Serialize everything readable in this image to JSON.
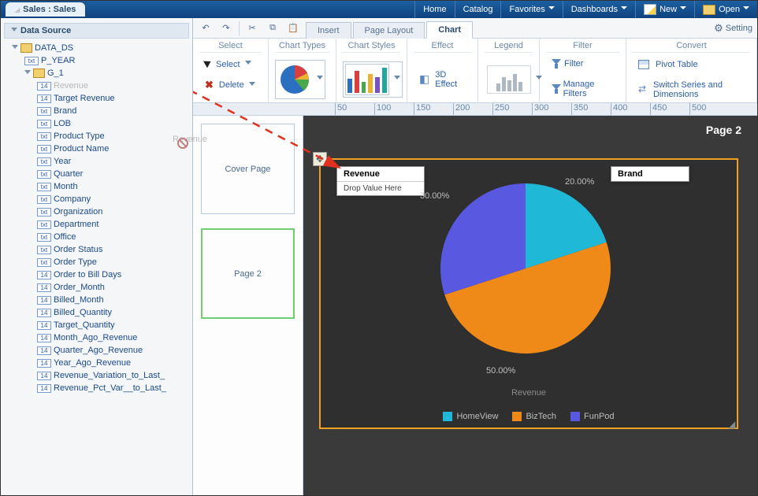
{
  "title": "Sales : Sales",
  "topmenu": {
    "home": "Home",
    "catalog": "Catalog",
    "favorites": "Favorites",
    "dashboards": "Dashboards",
    "new": "New",
    "open": "Open"
  },
  "sidebar": {
    "heading": "Data Source",
    "root": "DATA_DS",
    "p_year": "P_YEAR",
    "group": "G_1",
    "fields": [
      {
        "k": "num",
        "l": "Revenue",
        "dim": true
      },
      {
        "k": "num",
        "l": "Target Revenue"
      },
      {
        "k": "txt",
        "l": "Brand"
      },
      {
        "k": "txt",
        "l": "LOB"
      },
      {
        "k": "txt",
        "l": "Product Type"
      },
      {
        "k": "txt",
        "l": "Product Name"
      },
      {
        "k": "txt",
        "l": "Year"
      },
      {
        "k": "txt",
        "l": "Quarter"
      },
      {
        "k": "txt",
        "l": "Month"
      },
      {
        "k": "txt",
        "l": "Company"
      },
      {
        "k": "txt",
        "l": "Organization"
      },
      {
        "k": "txt",
        "l": "Department"
      },
      {
        "k": "txt",
        "l": "Office"
      },
      {
        "k": "txt",
        "l": "Order Status"
      },
      {
        "k": "txt",
        "l": "Order Type"
      },
      {
        "k": "num",
        "l": "Order to Bill Days"
      },
      {
        "k": "num",
        "l": "Order_Month"
      },
      {
        "k": "num",
        "l": "Billed_Month"
      },
      {
        "k": "num",
        "l": "Billed_Quantity"
      },
      {
        "k": "num",
        "l": "Target_Quantity"
      },
      {
        "k": "num",
        "l": "Month_Ago_Revenue"
      },
      {
        "k": "num",
        "l": "Quarter_Ago_Revenue"
      },
      {
        "k": "num",
        "l": "Year_Ago_Revenue"
      },
      {
        "k": "num",
        "l": "Revenue_Variation_to_Last_"
      },
      {
        "k": "num",
        "l": "Revenue_Pct_Var__to_Last_"
      }
    ]
  },
  "toolbar": {
    "tabs": {
      "insert": "Insert",
      "pagelayout": "Page Layout",
      "chart": "Chart"
    },
    "setting": "Setting"
  },
  "ribbon": {
    "select_hdr": "Select",
    "select": "Select",
    "delete": "Delete",
    "chart_types": "Chart Types",
    "chart_styles": "Chart Styles",
    "effect": "Effect",
    "effect_3d": "3D Effect",
    "legend": "Legend",
    "filter_hdr": "Filter",
    "filter": "Filter",
    "manage_filters": "Manage Filters",
    "convert_hdr": "Convert",
    "pivot": "Pivot Table",
    "switch": "Switch Series and Dimensions"
  },
  "ruler_ticks": [
    50,
    100,
    150,
    200,
    250,
    300,
    350,
    400,
    450,
    500
  ],
  "thumbs": {
    "cover": "Cover Page",
    "page2": "Page 2"
  },
  "canvas": {
    "page_title": "Page 2",
    "drop_revenue_hdr": "Revenue",
    "drop_revenue_hint": "Drop Value Here",
    "drop_brand_hdr": "Brand",
    "axis_label": "Revenue",
    "legend": {
      "a": "HomeView",
      "b": "BizTech",
      "c": "FunPod"
    },
    "pct": {
      "a": "20.00%",
      "b": "50.00%",
      "c": "30.00%"
    },
    "colors": {
      "a": "#1fb8d6",
      "b": "#ef8a18",
      "c": "#5858e0"
    }
  },
  "drag_ghost": "Revenue",
  "chart_data": {
    "type": "pie",
    "title": "Revenue",
    "series_name": "Brand",
    "categories": [
      "HomeView",
      "BizTech",
      "FunPod"
    ],
    "values": [
      20.0,
      50.0,
      30.0
    ],
    "value_format": "percent",
    "colors": [
      "#1fb8d6",
      "#ef8a18",
      "#5858e0"
    ]
  }
}
